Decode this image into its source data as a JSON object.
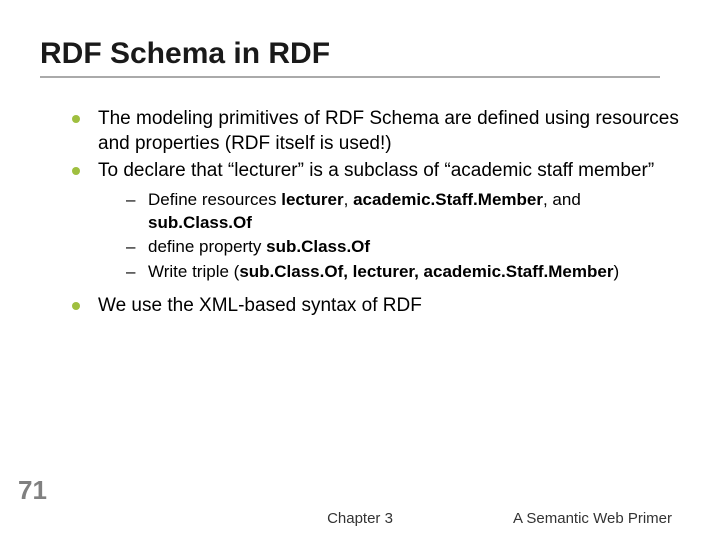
{
  "slide": {
    "title": "RDF Schema in RDF",
    "number": "71",
    "bullets": {
      "b1": "The modeling primitives of RDF Schema are defined using resources and properties (RDF itself is used!)",
      "b2": "To declare that “lecturer” is a subclass of “academic staff member”"
    },
    "sub": {
      "s1a": "Define resources ",
      "s1b1": "lecturer",
      "s1c": ", ",
      "s1b2": "academic.Staff.Member",
      "s1d": ", and ",
      "s1b3": "sub.Class.Of",
      "s2a": "define property ",
      "s2b": "sub.Class.Of",
      "s3a": "Write triple (",
      "s3b": "sub.Class.Of, lecturer, academic.Staff.Member",
      "s3c": ")"
    },
    "conclusion": "We use the XML-based syntax of RDF",
    "footer_center": "Chapter 3",
    "footer_right": "A Semantic Web Primer"
  }
}
